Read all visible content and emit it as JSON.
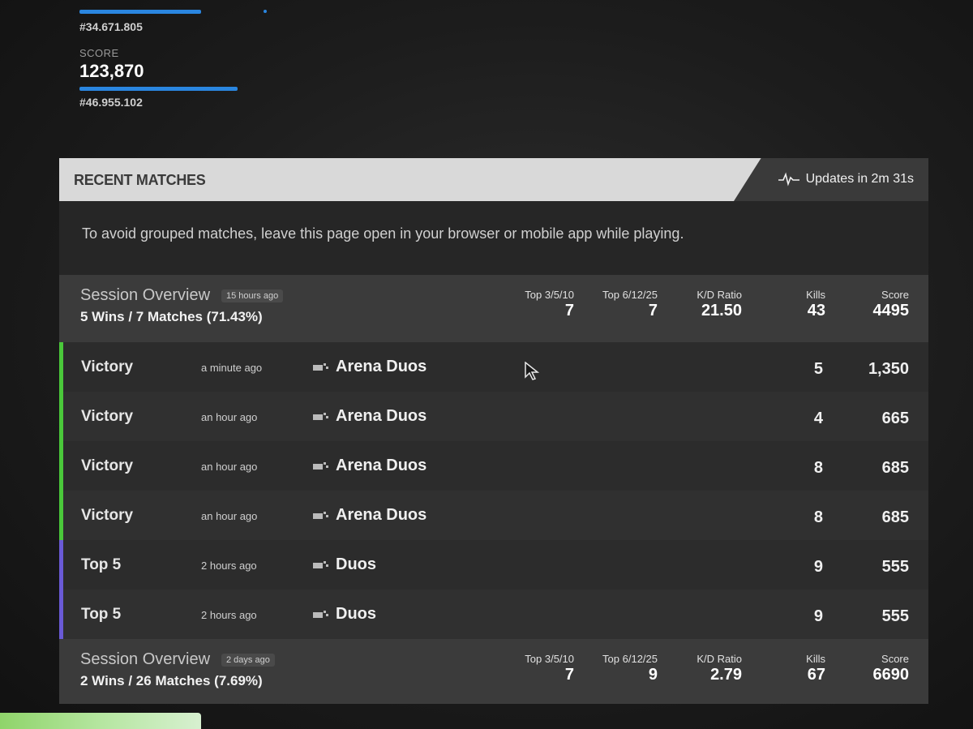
{
  "stats": {
    "top_rank": "#34.671.805",
    "score_label": "SCORE",
    "score_value": "123,870",
    "score_rank": "#46.955.102"
  },
  "recent_matches": {
    "title": "RECENT MATCHES",
    "update_text": "Updates in 2m 31s",
    "update_icon": "pulse-icon",
    "notice": "To avoid grouped matches, leave this page open in your browser or mobile app while playing."
  },
  "colors": {
    "victory": "#4ac83a",
    "top5": "#6a5ad6",
    "accent_blue": "#2a86e0"
  },
  "session1": {
    "title": "Session Overview",
    "badge": "15 hours ago",
    "summary": "5 Wins / 7 Matches (71.43%)",
    "cols": [
      {
        "label": "Top 3/5/10",
        "value": "7"
      },
      {
        "label": "Top 6/12/25",
        "value": "7"
      },
      {
        "label": "K/D Ratio",
        "value": "21.50"
      },
      {
        "label": "Kills",
        "value": "43"
      },
      {
        "label": "Score",
        "value": "4495"
      }
    ]
  },
  "matches": [
    {
      "result": "Victory",
      "time": "a minute ago",
      "mode": "Arena Duos",
      "kills": "5",
      "score": "1,350"
    },
    {
      "result": "Victory",
      "time": "an hour ago",
      "mode": "Arena Duos",
      "kills": "4",
      "score": "665"
    },
    {
      "result": "Victory",
      "time": "an hour ago",
      "mode": "Arena Duos",
      "kills": "8",
      "score": "685"
    },
    {
      "result": "Victory",
      "time": "an hour ago",
      "mode": "Arena Duos",
      "kills": "8",
      "score": "685"
    },
    {
      "result": "Top 5",
      "time": "2 hours ago",
      "mode": "Duos",
      "kills": "9",
      "score": "555"
    },
    {
      "result": "Top 5",
      "time": "2 hours ago",
      "mode": "Duos",
      "kills": "9",
      "score": "555"
    }
  ],
  "session2": {
    "title": "Session Overview",
    "badge": "2 days ago",
    "summary": "2 Wins / 26 Matches (7.69%)",
    "cols": [
      {
        "label": "Top 3/5/10",
        "value": "7"
      },
      {
        "label": "Top 6/12/25",
        "value": "9"
      },
      {
        "label": "K/D Ratio",
        "value": "2.79"
      },
      {
        "label": "Kills",
        "value": "67"
      },
      {
        "label": "Score",
        "value": "6690"
      }
    ]
  }
}
